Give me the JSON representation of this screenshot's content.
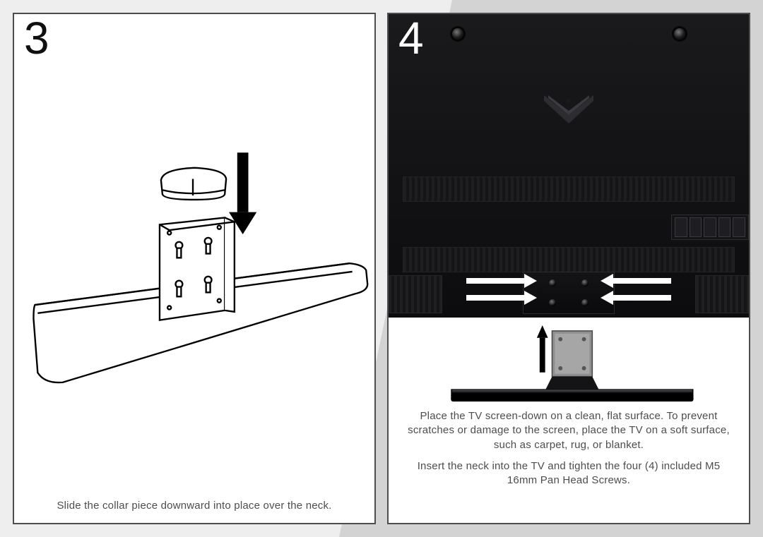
{
  "steps": {
    "s3": {
      "number": "3",
      "caption": "Slide the collar piece downward into place over the neck."
    },
    "s4": {
      "number": "4",
      "caption1": "Place the TV screen-down on a clean, flat surface. To prevent scratches or damage to the screen, place the TV on a soft surface, such as carpet, rug, or blanket.",
      "caption2": "Insert the neck into the TV and tighten the four (4) included M5 16mm Pan Head Screws."
    }
  }
}
